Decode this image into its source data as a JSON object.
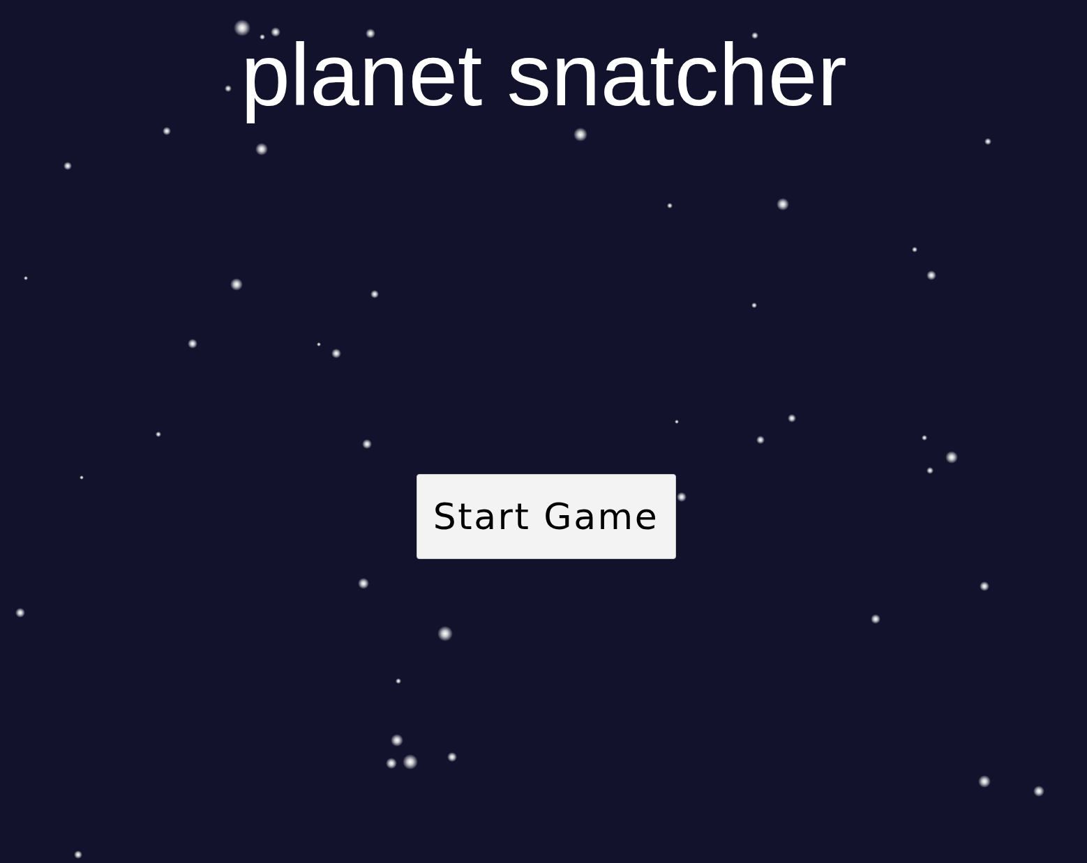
{
  "title": "planet snatcher",
  "start_button": {
    "label": "Start Game"
  }
}
